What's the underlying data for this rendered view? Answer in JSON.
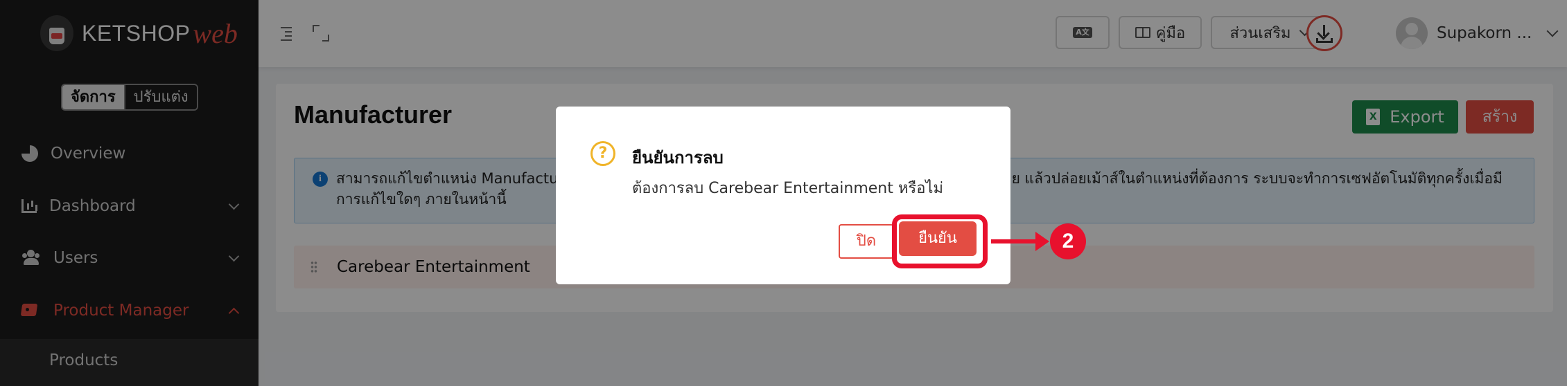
{
  "app": {
    "brand": "KETSHOP",
    "brand_suffix": "web"
  },
  "sidebar": {
    "mode_tabs": [
      {
        "label": "จัดการ",
        "active": true
      },
      {
        "label": "ปรับแต่ง",
        "active": false
      }
    ],
    "items": [
      {
        "label": "Overview",
        "icon": "pie-chart-icon"
      },
      {
        "label": "Dashboard",
        "icon": "bar-chart-icon",
        "expandable": true
      },
      {
        "label": "Users",
        "icon": "users-icon",
        "expandable": true
      },
      {
        "label": "Product Manager",
        "icon": "tag-icon",
        "expandable": true,
        "active": true
      }
    ],
    "sub_items": [
      {
        "label": "Products"
      }
    ]
  },
  "topbar": {
    "lang_icon": "translate-icon",
    "manual_label": "คู่มือ",
    "addon_label": "ส่วนเสริม",
    "user_name": "Supakorn ..."
  },
  "page": {
    "title": "Manufacturer",
    "export_label": "Export",
    "create_label": "สร้าง",
    "info_text_left": "สามารถแก้ไขตำแหน่ง Manufactu",
    "info_text_right": "ย้าย แล้วปล่อยเม้าส์ในตำแหน่งที่ต้องการ ระบบจะทำการเซฟอัตโนมัติทุกครั้งเมื่อมี",
    "info_text_line2": "การแก้ไขใดๆ ภายในหน้านี้",
    "rows": [
      {
        "name": "Carebear Entertainment"
      }
    ]
  },
  "modal": {
    "title": "ยืนยันการลบ",
    "message": "ต้องการลบ Carebear Entertainment หรือไม่",
    "close_label": "ปิด",
    "confirm_label": "ยืนยัน"
  },
  "annotation": {
    "step": "2"
  },
  "colors": {
    "accent": "#e34d43",
    "export_green": "#1e8a4c",
    "sidebar_bg": "#1c1c1c",
    "annotation_red": "#e8112d",
    "warning": "#f0b429",
    "info_blue": "#1677d2"
  }
}
